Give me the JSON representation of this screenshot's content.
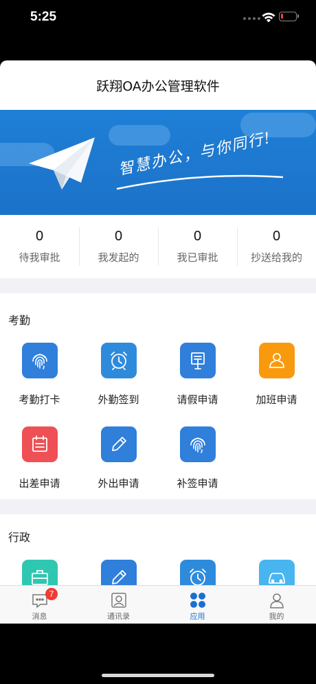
{
  "status_bar": {
    "time": "5:25"
  },
  "header": {
    "title": "跃翔OA办公管理软件"
  },
  "banner": {
    "slogan": "智慧办公，与你同行!"
  },
  "stats": [
    {
      "count": "0",
      "label": "待我审批"
    },
    {
      "count": "0",
      "label": "我发起的"
    },
    {
      "count": "0",
      "label": "我已审批"
    },
    {
      "count": "0",
      "label": "抄送给我的"
    }
  ],
  "sections": [
    {
      "title": "考勤",
      "apps": [
        {
          "label": "考勤打卡",
          "icon": "fingerprint-icon",
          "color": "#2f7fdb"
        },
        {
          "label": "外勤签到",
          "icon": "alarm-clock-icon",
          "color": "#2e8bdc"
        },
        {
          "label": "请假申请",
          "icon": "signboard-icon",
          "color": "#2f7fdb"
        },
        {
          "label": "加班申请",
          "icon": "user-icon",
          "color": "#f99a0e"
        },
        {
          "label": "出差申请",
          "icon": "calendar-icon",
          "color": "#ef5055"
        },
        {
          "label": "外出申请",
          "icon": "pencil-icon",
          "color": "#2f7fdb"
        },
        {
          "label": "补签申请",
          "icon": "fingerprint-icon",
          "color": "#2f7fdb"
        }
      ]
    },
    {
      "title": "行政",
      "apps": [
        {
          "label": "",
          "icon": "briefcase-icon",
          "color": "#2fc7b1"
        },
        {
          "label": "",
          "icon": "pencil-icon",
          "color": "#2f7fdb"
        },
        {
          "label": "",
          "icon": "alarm-clock-icon",
          "color": "#2e8bdc"
        },
        {
          "label": "",
          "icon": "car-icon",
          "color": "#48b5f0"
        }
      ]
    }
  ],
  "tabbar": {
    "tabs": [
      {
        "label": "消息",
        "icon": "message-icon",
        "badge": "7"
      },
      {
        "label": "通讯录",
        "icon": "contacts-icon"
      },
      {
        "label": "应用",
        "icon": "apps-grid-icon",
        "active": true
      },
      {
        "label": "我的",
        "icon": "person-icon"
      }
    ],
    "active_color": "#1a6fd0"
  }
}
